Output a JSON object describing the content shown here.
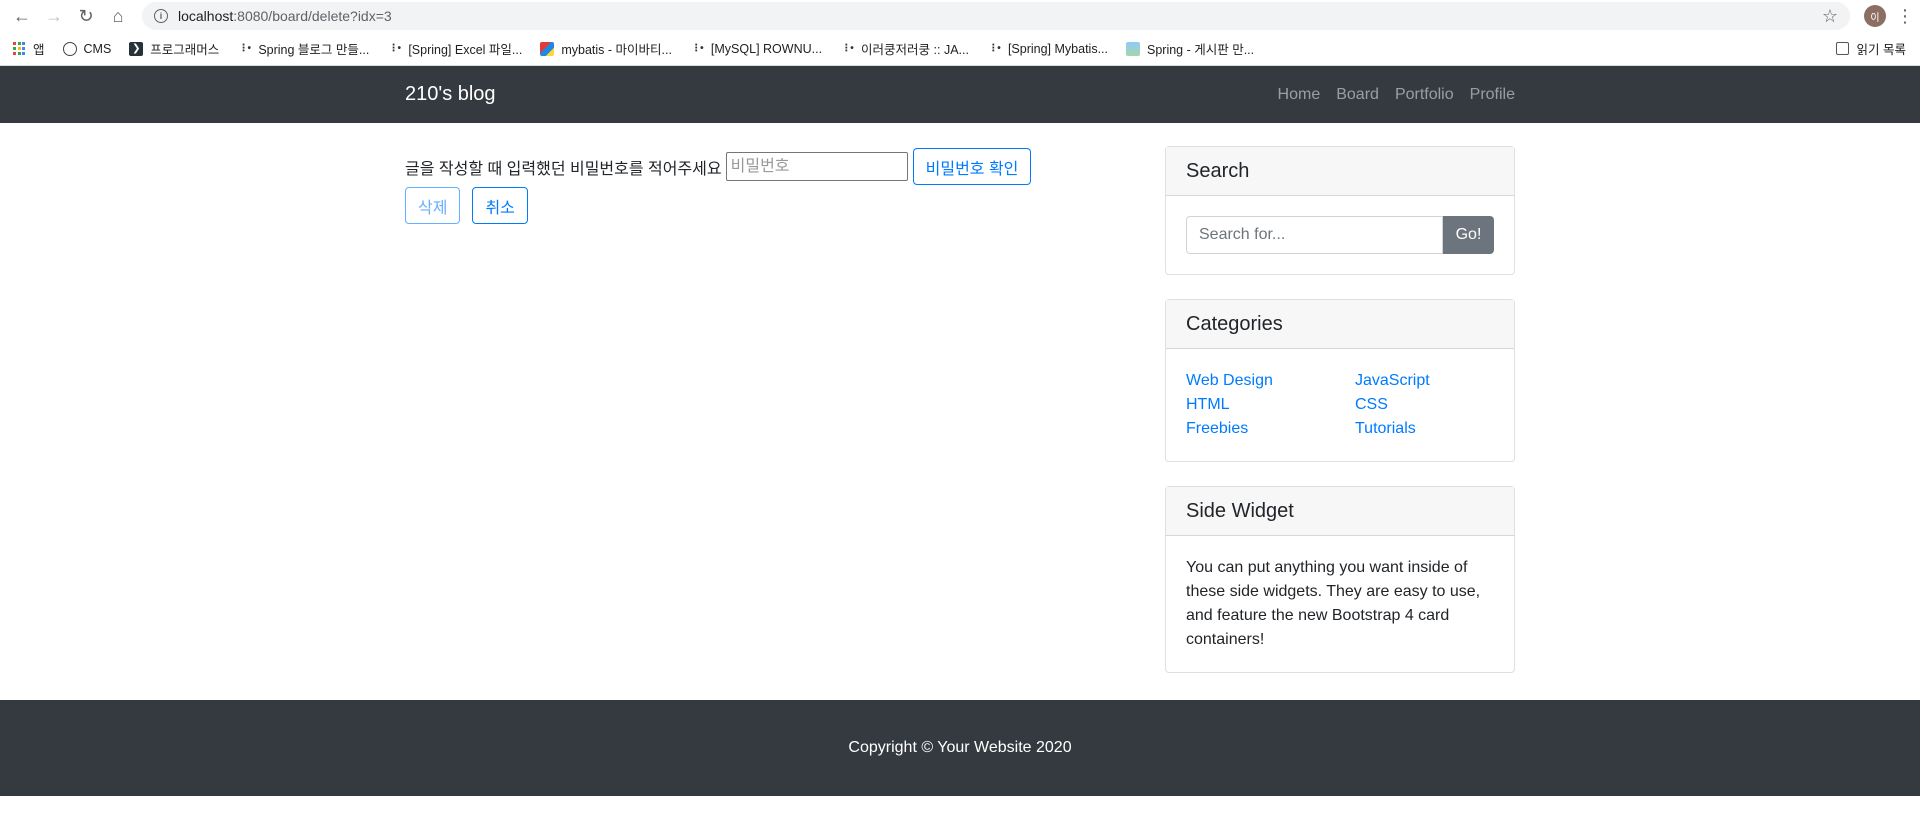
{
  "browser": {
    "url_host": "localhost",
    "url_path": ":8080/board/delete?idx=3",
    "avatar_letter": "이",
    "bookmarks": [
      {
        "label": "앱",
        "icon": "apps-icon"
      },
      {
        "label": "CMS",
        "icon": "globe-icon"
      },
      {
        "label": "프로그래머스",
        "icon": "programmers-icon"
      },
      {
        "label": "Spring 블로그 만들...",
        "icon": "tistory-icon"
      },
      {
        "label": "[Spring] Excel 파일...",
        "icon": "tistory-icon"
      },
      {
        "label": "mybatis - 마이바티...",
        "icon": "mybatis-icon"
      },
      {
        "label": "[MySQL] ROWNU...",
        "icon": "tistory-icon"
      },
      {
        "label": "이러쿵저러쿵 :: JA...",
        "icon": "tistory-icon"
      },
      {
        "label": "[Spring] Mybatis...",
        "icon": "tistory-icon"
      },
      {
        "label": "Spring - 게시판 만...",
        "icon": "photo-icon"
      }
    ],
    "reading_list": "읽기 목록"
  },
  "navbar": {
    "brand": "210's blog",
    "links": [
      "Home",
      "Board",
      "Portfolio",
      "Profile"
    ]
  },
  "main": {
    "prompt": "글을 작성할 때 입력했던 비밀번호를 적어주세요",
    "password_placeholder": "비밀번호",
    "confirm_label": "비밀번호 확인",
    "delete_label": "삭제",
    "cancel_label": "취소"
  },
  "sidebar": {
    "search": {
      "title": "Search",
      "placeholder": "Search for...",
      "go_label": "Go!"
    },
    "categories": {
      "title": "Categories",
      "items": [
        "Web Design",
        "JavaScript",
        "HTML",
        "CSS",
        "Freebies",
        "Tutorials"
      ]
    },
    "widget": {
      "title": "Side Widget",
      "text": "You can put anything you want inside of these side widgets. They are easy to use, and feature the new Bootstrap 4 card containers!"
    }
  },
  "footer": {
    "copyright": "Copyright © Your Website 2020"
  },
  "colors": {
    "navbar": "#343a40",
    "link": "#007bff",
    "go_button": "#6c757d"
  }
}
